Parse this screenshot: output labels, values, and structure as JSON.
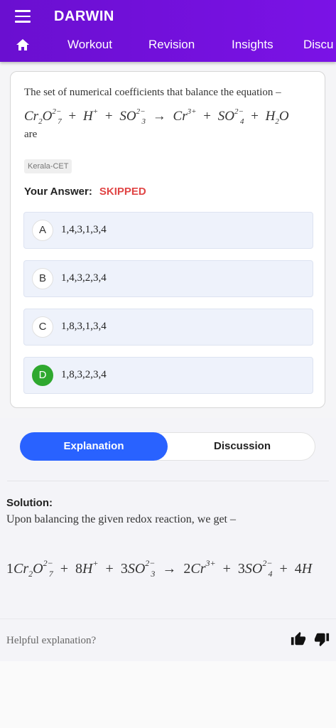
{
  "header": {
    "app_title": "DARWIN",
    "menu_icon": "hamburger-menu-icon",
    "home_icon": "home-icon",
    "tabs": [
      {
        "label": "Workout"
      },
      {
        "label": "Revision"
      },
      {
        "label": "Insights"
      },
      {
        "label": "Discu"
      }
    ]
  },
  "question": {
    "text": "The set of numerical coefficients that balance the equation –",
    "equation": {
      "t1": "Cr",
      "s1": "2",
      "t2": "O",
      "p2": "2−",
      "s2": "7",
      "op1": "+",
      "t3": "H",
      "p3": "+",
      "op2": "+",
      "t4": "SO",
      "p4": "2−",
      "s4": "3",
      "arrow": "→",
      "t5": "Cr",
      "p5": "3+",
      "op3": "+",
      "t6": "SO",
      "p6": "2−",
      "s6": "4",
      "op4": "+",
      "t7": "H",
      "s7": "2",
      "t8": "O"
    },
    "suffix": "are",
    "source_tag": "Kerala-CET",
    "answer_label": "Your Answer:",
    "answer_value": "SKIPPED"
  },
  "options": [
    {
      "letter": "A",
      "text": "1,4,3,1,3,4"
    },
    {
      "letter": "B",
      "text": "1,4,3,2,3,4"
    },
    {
      "letter": "C",
      "text": "1,8,3,1,3,4"
    },
    {
      "letter": "D",
      "text": "1,8,3,2,3,4"
    }
  ],
  "correct_option": "D",
  "colors": {
    "header": "#6a0fd0",
    "active_tab": "#2962ff",
    "correct": "#2fa82f",
    "skipped": "#e04545"
  },
  "tabs2": {
    "explanation": "Explanation",
    "discussion": "Discussion"
  },
  "solution": {
    "title": "Solution:",
    "text": "Upon balancing the given redox reaction, we get –",
    "equation": {
      "c1": "1",
      "t1": "Cr",
      "s1": "2",
      "t2": "O",
      "p2": "2−",
      "s2": "7",
      "op1": "+",
      "c2": "8",
      "t3": "H",
      "p3": "+",
      "op2": "+",
      "c3": "3",
      "t4": "SO",
      "p4": "2−",
      "s4": "3",
      "arrow": "→",
      "c4": "2",
      "t5": "Cr",
      "p5": "3+",
      "op3": "+",
      "c5": "3",
      "t6": "SO",
      "p6": "2−",
      "s6": "4",
      "op4": "+",
      "c6": "4",
      "t7": "H"
    }
  },
  "feedback": {
    "label": "Helpful explanation?",
    "up_icon": "thumbs-up-icon",
    "down_icon": "thumbs-down-icon"
  }
}
